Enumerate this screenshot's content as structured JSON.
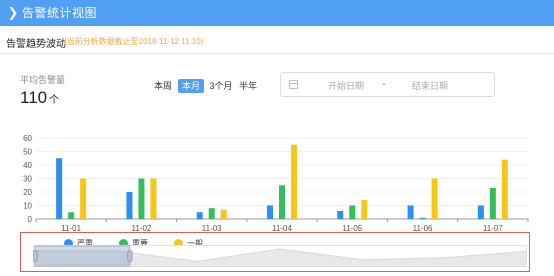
{
  "header": {
    "title": "告警统计视图",
    "chevron_icon": "chevron-right-icon"
  },
  "section": {
    "title": "告警趋势波动",
    "note": "(当前分析数据截止至2018-11-12 11:10)"
  },
  "stats": {
    "label": "平均告警量",
    "value": "110",
    "unit": "个"
  },
  "periods": [
    {
      "label": "本周",
      "active": false
    },
    {
      "label": "本月",
      "active": true
    },
    {
      "label": "3个月",
      "active": false
    },
    {
      "label": "半年",
      "active": false
    }
  ],
  "date_range": {
    "start_placeholder": "开始日期",
    "separator": "-",
    "end_placeholder": "结束日期",
    "calendar_icon": "calendar-icon"
  },
  "chart_data": {
    "type": "bar",
    "categories": [
      "11-01",
      "11-02",
      "11-03",
      "11-04",
      "11-05",
      "11-06",
      "11-07"
    ],
    "series": [
      {
        "name": "严重",
        "color": "#2b8ff5",
        "values": [
          45,
          20,
          5,
          10,
          6,
          10,
          10
        ]
      },
      {
        "name": "重要",
        "color": "#35bd5c",
        "values": [
          5,
          30,
          8,
          25,
          10,
          1,
          23
        ]
      },
      {
        "name": "一般",
        "color": "#f5c518",
        "values": [
          30,
          30,
          7,
          55,
          14,
          30,
          44
        ]
      }
    ],
    "ylim": [
      0,
      60
    ],
    "yticks": [
      0,
      10,
      20,
      30,
      40,
      50,
      60
    ],
    "grid": true,
    "legend_position": "bottom",
    "datazoom": {
      "start_fraction": 0.0,
      "end_fraction": 0.2
    }
  }
}
